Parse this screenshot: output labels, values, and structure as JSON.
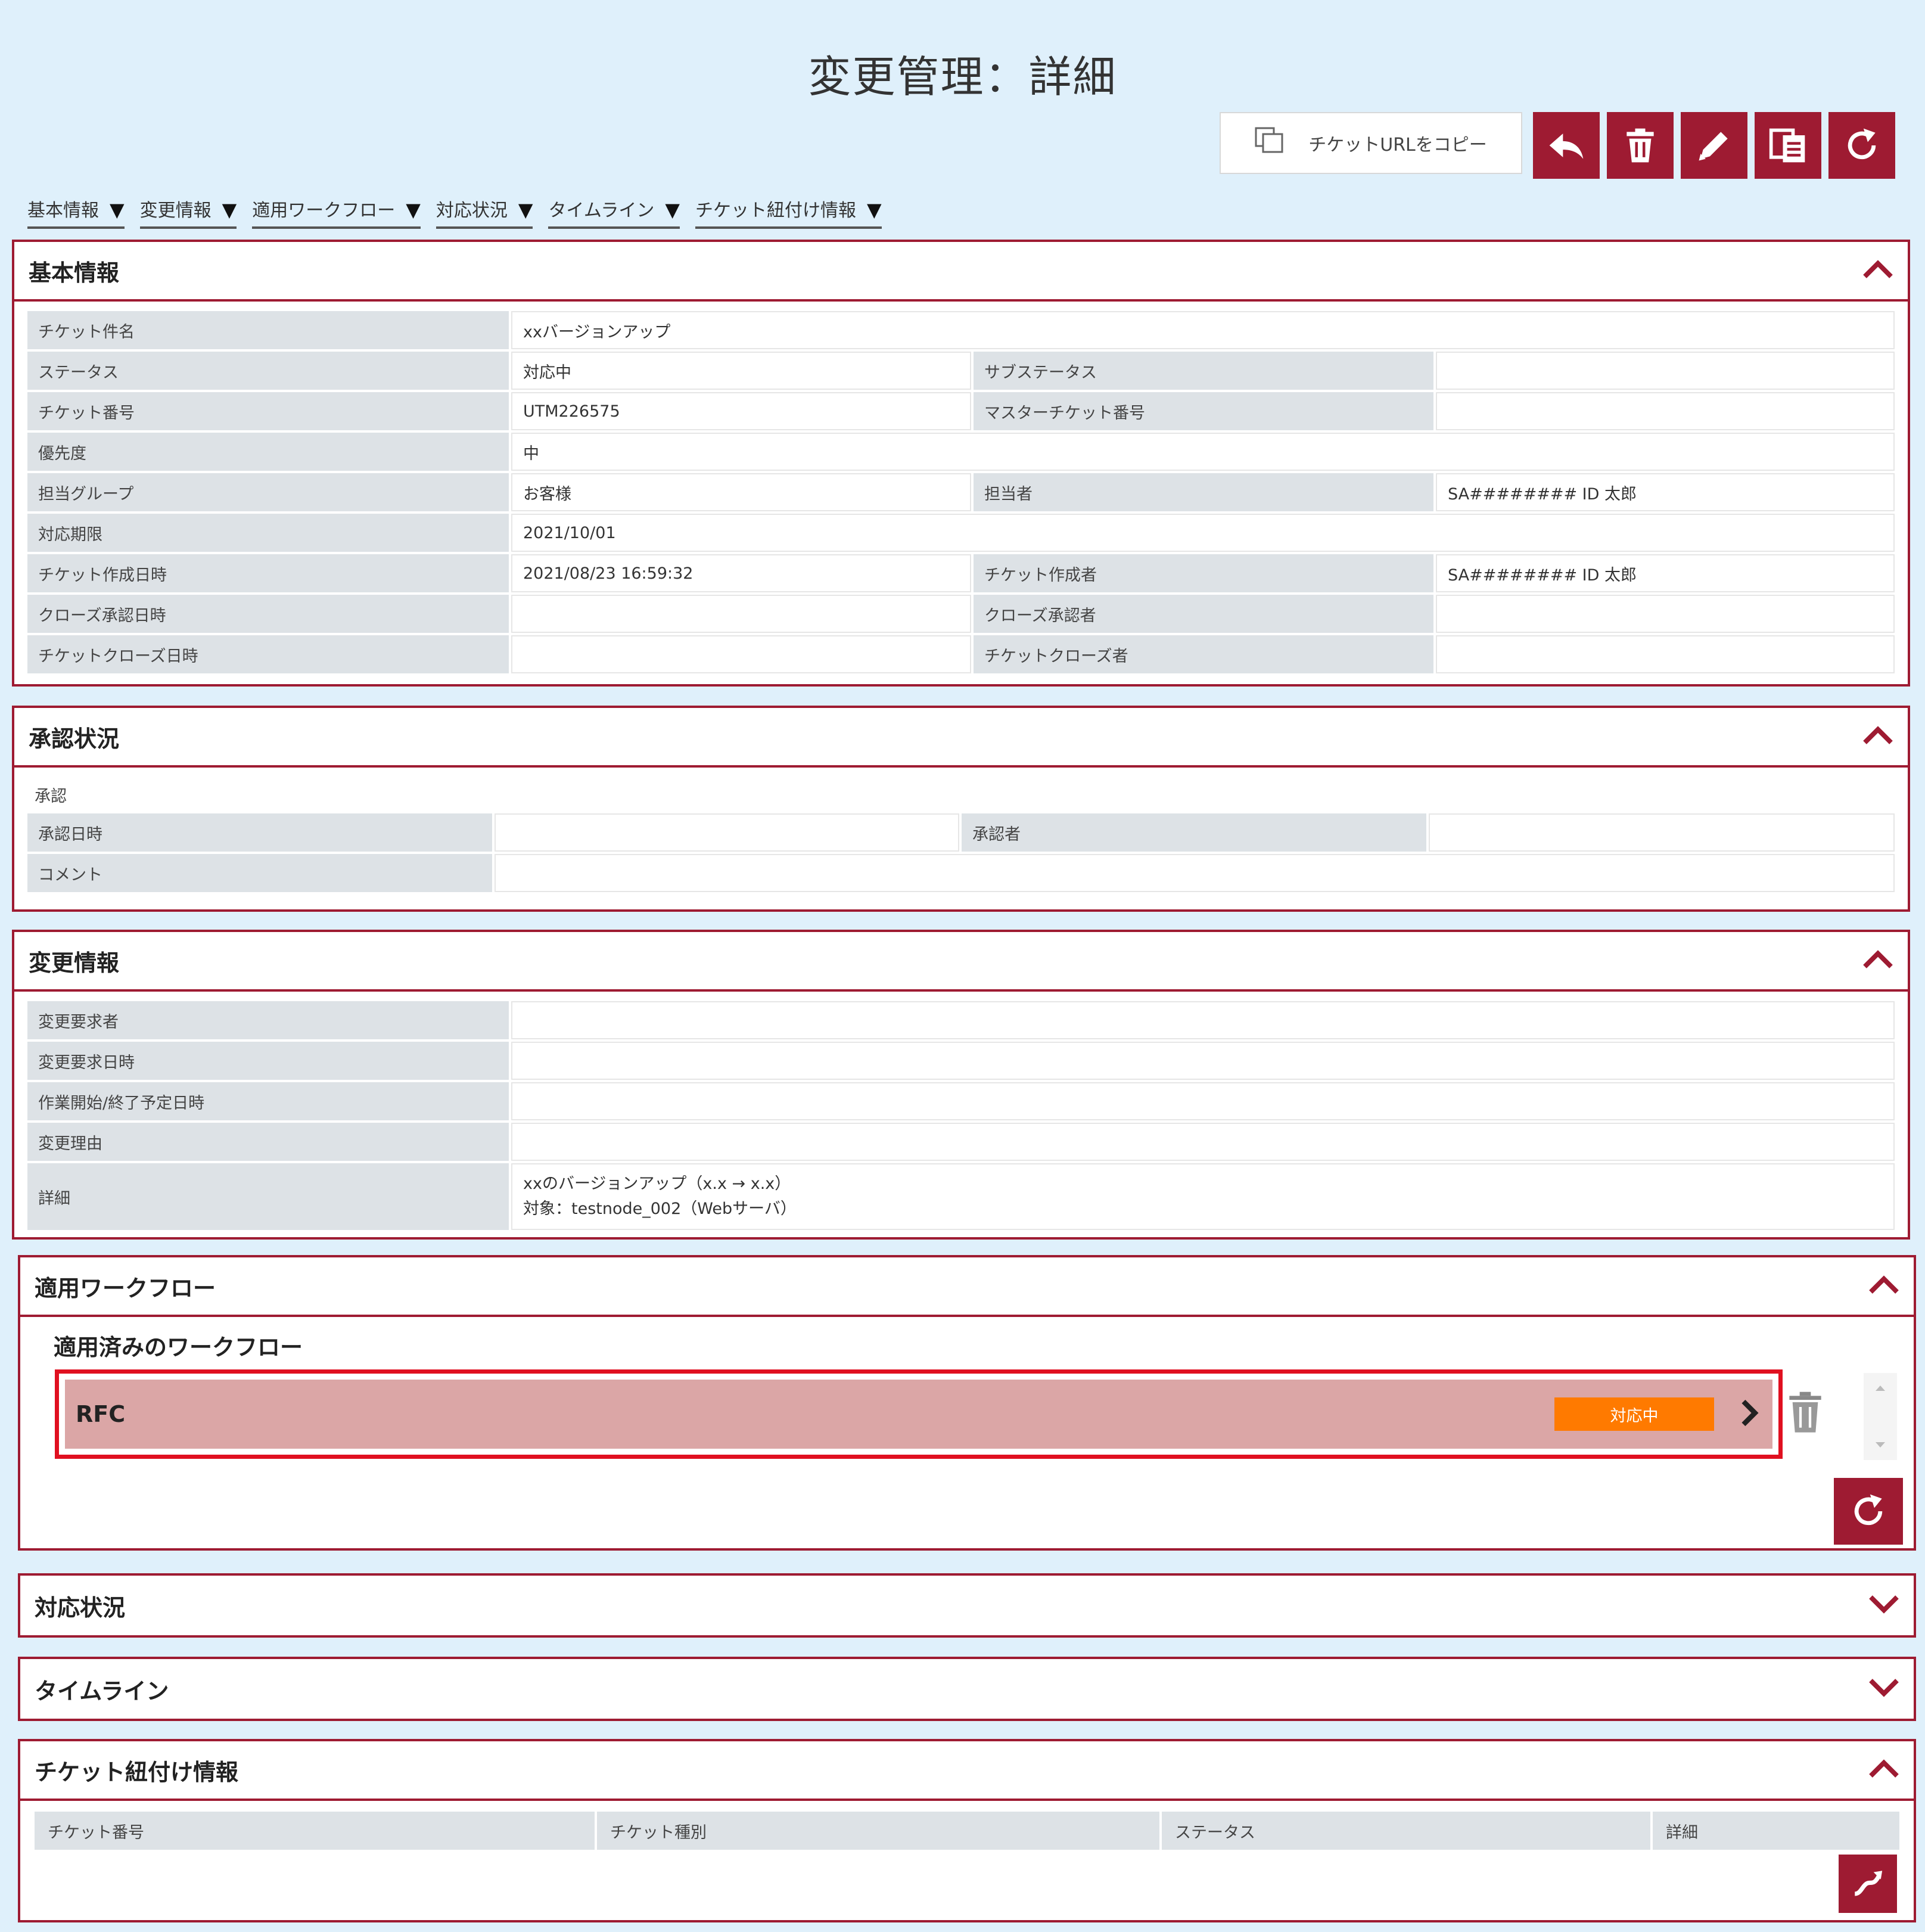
{
  "page_title": "変更管理：詳細",
  "toolbar": {
    "copy_url_label": "チケットURLをコピー",
    "buttons": [
      {
        "name": "back",
        "icon": "reply-arrow-icon"
      },
      {
        "name": "delete",
        "icon": "trash-icon"
      },
      {
        "name": "edit",
        "icon": "pencil-icon"
      },
      {
        "name": "copy-ticket",
        "icon": "copy-doc-icon"
      },
      {
        "name": "refresh",
        "icon": "refresh-icon"
      }
    ]
  },
  "anchors": [
    "基本情報",
    "変更情報",
    "適用ワークフロー",
    "対応状況",
    "タイムライン",
    "チケット紐付け情報"
  ],
  "anchor_marker": "▼",
  "basic": {
    "title": "基本情報",
    "ticket_name_label": "チケット件名",
    "ticket_name": "xxバージョンアップ",
    "status_label": "ステータス",
    "status": "対応中",
    "substatus_label": "サブステータス",
    "substatus": "",
    "ticket_no_label": "チケット番号",
    "ticket_no": "UTM226575",
    "master_ticket_label": "マスターチケット番号",
    "master_ticket": "",
    "priority_label": "優先度",
    "priority": "中",
    "group_label": "担当グループ",
    "group": "お客様",
    "assignee_label": "担当者",
    "assignee": "SA######## ID 太郎",
    "due_label": "対応期限",
    "due": "2021/10/01",
    "created_label": "チケット作成日時",
    "created": "2021/08/23 16:59:32",
    "creator_label": "チケット作成者",
    "creator": "SA######## ID 太郎",
    "close_approved_label": "クローズ承認日時",
    "close_approved": "",
    "close_approver_label": "クローズ承認者",
    "close_approver": "",
    "closed_label": "チケットクローズ日時",
    "closed": "",
    "closer_label": "チケットクローズ者",
    "closer": ""
  },
  "approval": {
    "title": "承認状況",
    "section_label": "承認",
    "date_label": "承認日時",
    "date": "",
    "approver_label": "承認者",
    "approver": "",
    "comment_label": "コメント",
    "comment": ""
  },
  "change": {
    "title": "変更情報",
    "requester_label": "変更要求者",
    "requester": "",
    "request_date_label": "変更要求日時",
    "request_date": "",
    "schedule_label": "作業開始/終了予定日時",
    "schedule": "",
    "reason_label": "変更理由",
    "reason": "",
    "detail_label": "詳細",
    "detail_line1": "xxのバージョンアップ（x.x → x.x）",
    "detail_line2": "対象：testnode_002（Webサーバ）"
  },
  "workflow": {
    "title": "適用ワークフロー",
    "subtitle": "適用済みのワークフロー",
    "items": [
      {
        "name": "RFC",
        "status": "対応中"
      }
    ]
  },
  "response": {
    "title": "対応状況"
  },
  "timeline": {
    "title": "タイムライン"
  },
  "links": {
    "title": "チケット紐付け情報",
    "columns": [
      "チケット番号",
      "チケット種別",
      "ステータス",
      "詳細"
    ]
  },
  "colors": {
    "accent": "#9e1b32",
    "status_orange": "#ff7a00",
    "highlight": "#e01020",
    "background": "#dff0fb"
  }
}
